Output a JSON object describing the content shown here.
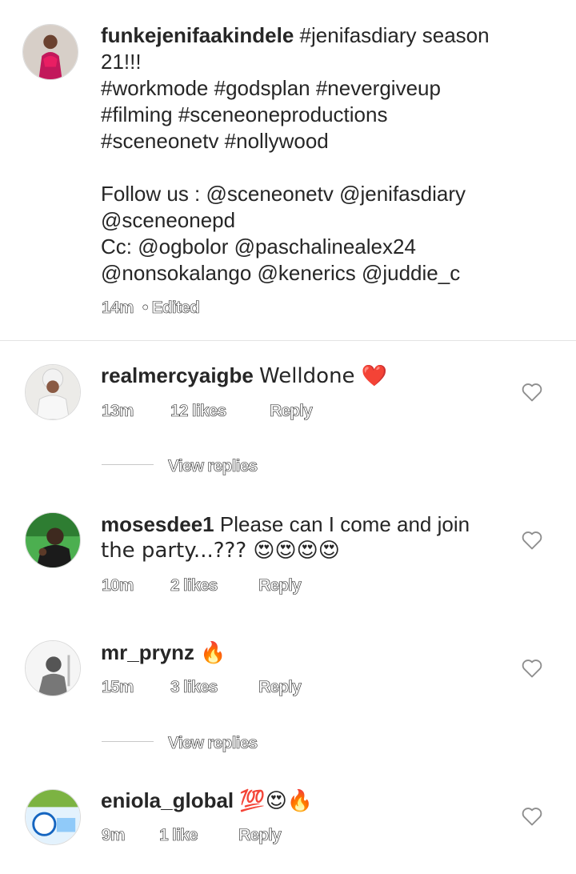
{
  "caption": {
    "username": "funkejenifaakindele",
    "lines": [
      "#jenifasdiary season",
      "21!!!",
      "#workmode #godsplan #nevergiveup",
      "#filming #sceneoneproductions",
      "#sceneonetv #nollywood",
      "",
      "Follow us : @sceneonetv @jenifasdiary",
      "@sceneonepd",
      "Cc: @ogbolor @paschalinealex24",
      "@nonsokalango @kenerics @juddie_c"
    ],
    "time": "14m",
    "edited": "• Edited"
  },
  "comments": [
    {
      "username": "realmercyaigbe",
      "text_lines": [
        "Welldone ❤️"
      ],
      "time": "13m",
      "likes": "12 likes",
      "reply": "Reply",
      "view_replies": "View replies"
    },
    {
      "username": "mosesdee1",
      "text_lines": [
        "Please can I come and join",
        "the party...??? 😍😍😍😍"
      ],
      "time": "10m",
      "likes": "2 likes",
      "reply": "Reply"
    },
    {
      "username": "mr_prynz",
      "text_lines": [
        "🔥"
      ],
      "time": "15m",
      "likes": "3 likes",
      "reply": "Reply",
      "view_replies": "View replies"
    },
    {
      "username": "eniola_global",
      "text_lines": [
        "💯😍🔥"
      ],
      "time": "9m",
      "likes": "1 like",
      "reply": "Reply"
    }
  ],
  "colors": {
    "heart_red": "#e0245e",
    "text": "#262626",
    "muted": "#8e8e8e"
  }
}
